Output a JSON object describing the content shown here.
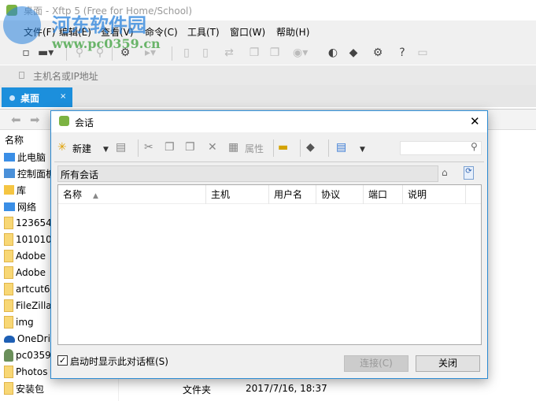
{
  "window": {
    "title": "桌面 - Xftp 5 (Free for Home/School)"
  },
  "watermark": {
    "name": "河东软件园",
    "url": "www.pc0359.cn"
  },
  "menu": [
    "文件(F)",
    "编辑(E)",
    "查看(V)",
    "命令(C)",
    "工具(T)",
    "窗口(W)",
    "帮助(H)"
  ],
  "address": {
    "placeholder": "主机名或IP地址"
  },
  "tab": {
    "label": "桌面",
    "close": "×"
  },
  "left_pane": {
    "header": "名称",
    "items": [
      "此电脑",
      "控制面板",
      "库",
      "网络",
      "123654",
      "101010",
      "Adobe",
      "Adobe",
      "artcut6",
      "FileZilla",
      "img",
      "OneDri",
      "pc0359",
      "Photos",
      "安装包"
    ],
    "last_row": {
      "type": "文件夹",
      "modified": "2017/7/16, 18:37"
    }
  },
  "dialog": {
    "title": "会话",
    "close": "✕",
    "toolbar": {
      "new": "新建",
      "properties": "属性"
    },
    "path": "所有会话",
    "columns": [
      "名称",
      "主机",
      "用户名",
      "协议",
      "端口",
      "说明"
    ],
    "startup_checkbox": {
      "label": "启动时显示此对话框(S)",
      "checked": true
    },
    "connect": "连接(C)",
    "close_button": "关闭"
  }
}
